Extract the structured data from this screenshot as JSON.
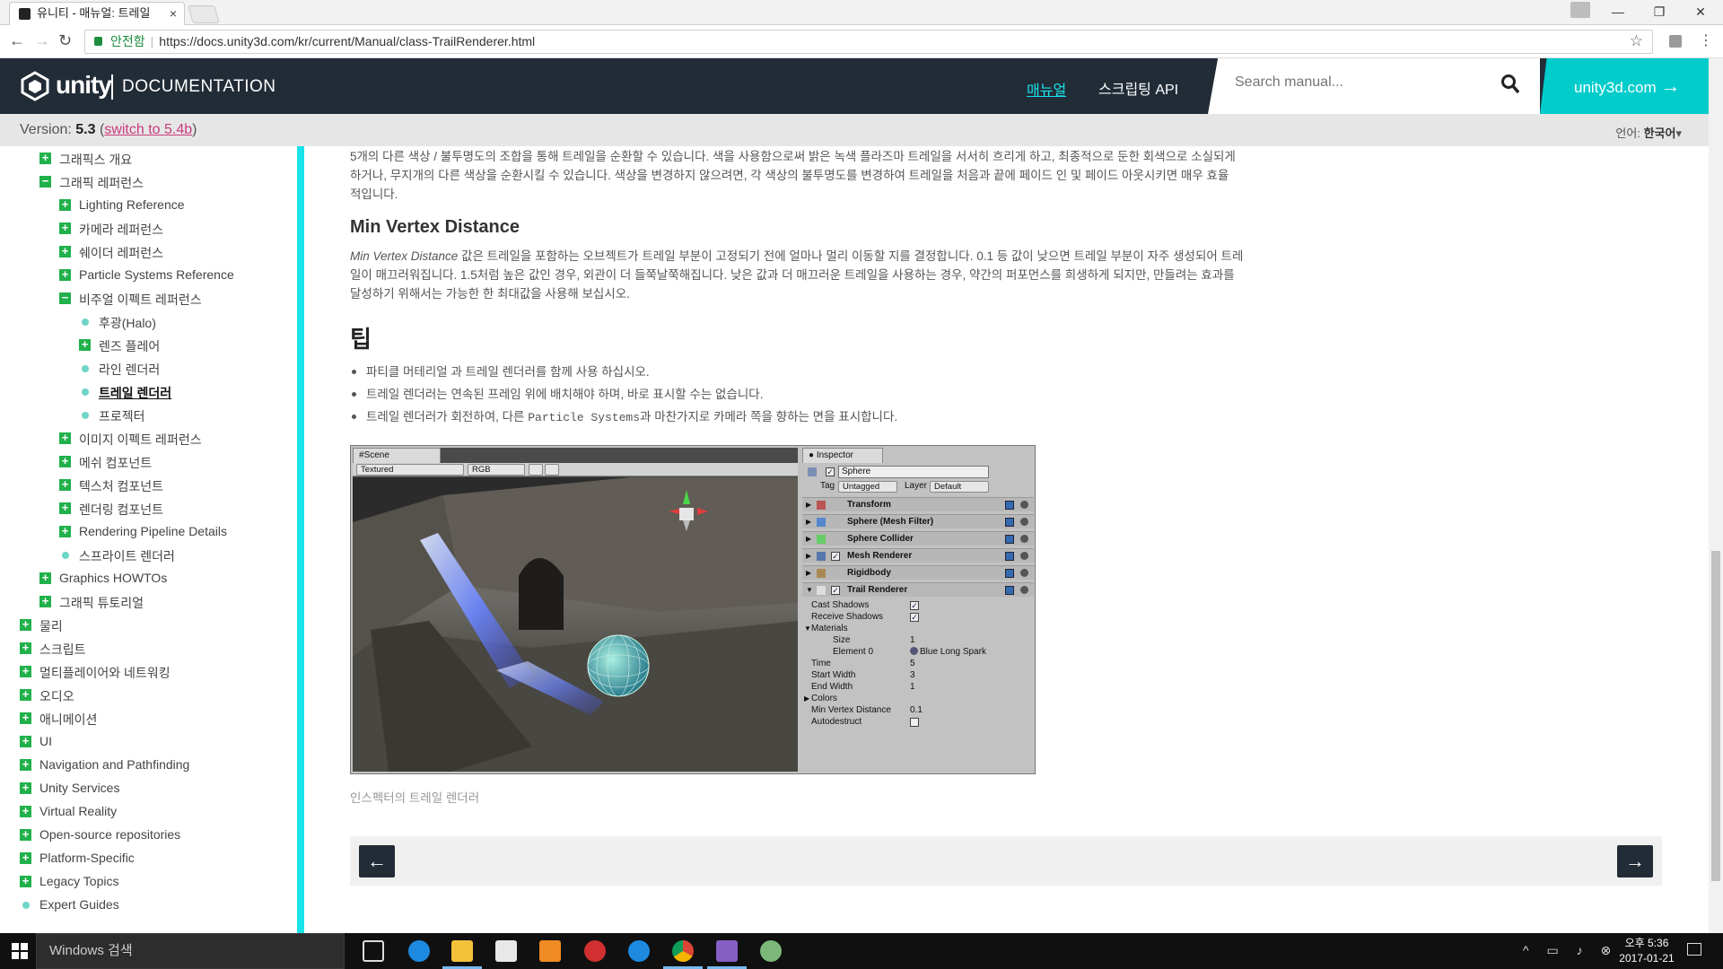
{
  "browser": {
    "tab_title": "유니티 - 매뉴얼: 트레일 ",
    "tab_close": "×",
    "url_secure_label": "안전함",
    "url": "https://docs.unity3d.com/kr/current/Manual/class-TrailRenderer.html",
    "url_separator": "|",
    "star": "☆",
    "minimize": "—",
    "maximize": "❐",
    "close": "✕",
    "back": "←",
    "forward": "→",
    "reload": "↻"
  },
  "header": {
    "brand": "unity",
    "section": "DOCUMENTATION",
    "nav_manual": "매뉴얼",
    "nav_api": "스크립팅 API",
    "search_placeholder": "Search manual...",
    "site_link": "unity3d.com",
    "site_link_arrow": "→"
  },
  "version_bar": {
    "label": "Version: ",
    "version": "5.3",
    "open_paren": " (",
    "switch_link": "switch to 5.4b",
    "close_paren": ")",
    "language_label": "언어: ",
    "language_value": "한국어",
    "language_caret": "▾"
  },
  "sidebar": {
    "items": [
      {
        "label": "그래픽스 개요",
        "marker": "plus"
      },
      {
        "label": "그래픽 레퍼런스",
        "marker": "minus"
      },
      {
        "label": "Lighting Reference",
        "marker": "plus"
      },
      {
        "label": "카메라 레퍼런스",
        "marker": "plus"
      },
      {
        "label": "쉐이더 레퍼런스",
        "marker": "plus"
      },
      {
        "label": "Particle Systems Reference",
        "marker": "plus"
      },
      {
        "label": "비주얼 이펙트 레퍼런스",
        "marker": "minus"
      },
      {
        "label": "후광(Halo)",
        "marker": "dot"
      },
      {
        "label": "렌즈 플레어",
        "marker": "plus"
      },
      {
        "label": "라인 렌더러",
        "marker": "dot"
      },
      {
        "label": "트레일 렌더러",
        "marker": "dot",
        "active": true
      },
      {
        "label": "프로젝터",
        "marker": "dot"
      },
      {
        "label": "이미지 이펙트 레퍼런스",
        "marker": "plus"
      },
      {
        "label": "메쉬 컴포넌트",
        "marker": "plus"
      },
      {
        "label": "텍스처 컴포넌트",
        "marker": "plus"
      },
      {
        "label": "렌더링 컴포넌트",
        "marker": "plus"
      },
      {
        "label": "Rendering Pipeline Details",
        "marker": "plus"
      },
      {
        "label": "스프라이트 렌더러",
        "marker": "dot"
      },
      {
        "label": "Graphics HOWTOs",
        "marker": "plus"
      },
      {
        "label": "그래픽 튜토리얼",
        "marker": "plus"
      },
      {
        "label": "물리",
        "marker": "plus"
      },
      {
        "label": "스크립트",
        "marker": "plus"
      },
      {
        "label": "멀티플레이어와 네트워킹",
        "marker": "plus"
      },
      {
        "label": "오디오",
        "marker": "plus"
      },
      {
        "label": "애니메이션",
        "marker": "plus"
      },
      {
        "label": "UI",
        "marker": "plus"
      },
      {
        "label": "Navigation and Pathfinding",
        "marker": "plus"
      },
      {
        "label": "Unity Services",
        "marker": "plus"
      },
      {
        "label": "Virtual Reality",
        "marker": "plus"
      },
      {
        "label": "Open-source repositories",
        "marker": "plus"
      },
      {
        "label": "Platform-Specific",
        "marker": "plus"
      },
      {
        "label": "Legacy Topics",
        "marker": "plus"
      },
      {
        "label": "Expert Guides",
        "marker": "dot"
      }
    ]
  },
  "content": {
    "intro_line1": "5개의 다른 색상 / 불투명도의 조합을 통해 트레일을 순환할 수 있습니다. 색을 사용함으로써 밝은 녹색 플라즈마 트레일을 서서히 흐리게 하고, 최종적으로 둔한 회색으로 소실되게",
    "intro_line2": "하거나, 무지개의 다른 색상을 순환시킬 수 있습니다. 색상을 변경하지 않으려면, 각 색상의 불투명도를 변경하여 트레일을 처음과 끝에 페이드 인 및 페이드 아웃시키면 매우 효율",
    "intro_line3": "적입니다.",
    "heading_mvd": "Min Vertex Distance",
    "mvd_term": "Min Vertex Distance",
    "mvd_line1": " 값은 트레일을 포함하는 오브젝트가 트레일 부분이 고정되기 전에 얼마나 멀리 이동할 지를 결정합니다. 0.1 등 값이 낮으면 트레일 부분이 자주 생성되어 트레",
    "mvd_line2": "일이 매끄러워집니다. 1.5처럼 높은 값인 경우, 외관이 더 들쭉날쭉해집니다. 낮은 값과 더 매끄러운 트레일을 사용하는 경우, 약간의 퍼포먼스를 희생하게 되지만, 만들려는 효과를",
    "mvd_line3": "달성하기 위해서는 가능한 한 최대값을 사용해 보십시오.",
    "heading_tips": "팁",
    "tip1": "파티클 머테리얼 과 트레일 렌더러를 함께 사용 하십시오.",
    "tip2": "트레일 렌더러는 연속된 프레임 위에 배치해야 하며, 바로 표시할 수는 없습니다.",
    "tip3_pre": "트레일 렌더러가 회전하여, 다른 ",
    "tip3_code": "Particle Systems",
    "tip3_post": "과 마찬가지로 카메라 쪽을 향하는 면을 표시합니다.",
    "caption": "인스펙터의 트레일 렌더러",
    "prev": "←",
    "next": "→"
  },
  "screenshot": {
    "scene_tab": "Scene",
    "shading": "Textured",
    "rgb": "RGB",
    "inspector_tab": "Inspector",
    "object_name": "Sphere",
    "tag_label": "Tag",
    "tag_value": "Untagged",
    "layer_label": "Layer",
    "layer_value": "Default",
    "components": [
      "Transform",
      "Sphere (Mesh Filter)",
      "Sphere Collider",
      "Mesh Renderer",
      "Rigidbody",
      "Trail Renderer"
    ],
    "props": [
      {
        "name": "Cast Shadows",
        "value": "✓"
      },
      {
        "name": "Receive Shadows",
        "value": "✓"
      },
      {
        "name": "Materials",
        "value": ""
      },
      {
        "name": "Size",
        "value": "1"
      },
      {
        "name": "Element 0",
        "value": "Blue Long Spark"
      },
      {
        "name": "Time",
        "value": "5"
      },
      {
        "name": "Start Width",
        "value": "3"
      },
      {
        "name": "End Width",
        "value": "1"
      },
      {
        "name": "Colors",
        "value": ""
      },
      {
        "name": "Min Vertex Distance",
        "value": "0.1"
      },
      {
        "name": "Autodestruct",
        "value": ""
      }
    ]
  },
  "taskbar": {
    "search_placeholder": "Windows 검색",
    "time": "오후 5:36",
    "date": "2017-01-21"
  }
}
